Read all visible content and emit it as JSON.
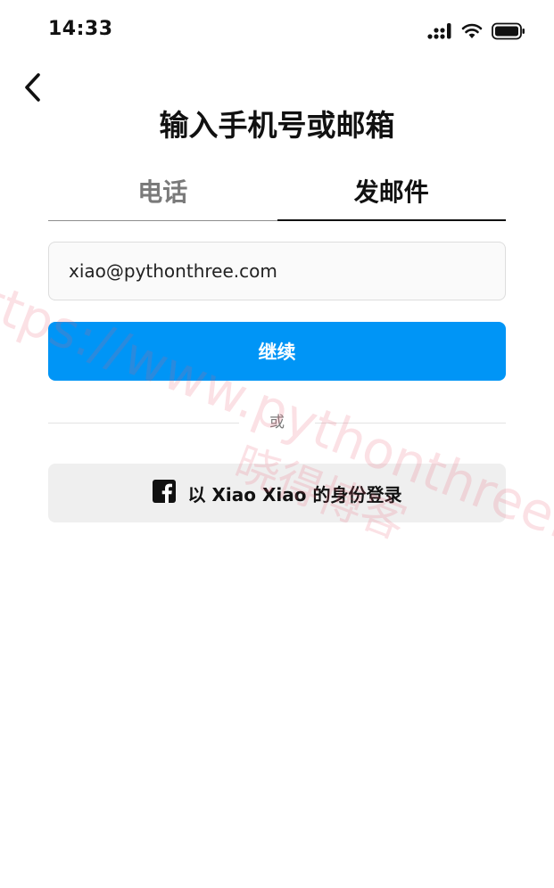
{
  "status_bar": {
    "time": "14:33"
  },
  "header": {
    "title": "输入手机号或邮箱"
  },
  "tabs": [
    {
      "label": "电话",
      "selected": false
    },
    {
      "label": "发邮件",
      "selected": true
    }
  ],
  "email_field": {
    "value": "xiao@pythonthree.com"
  },
  "continue_button": {
    "label": "继续"
  },
  "divider": {
    "text": "或"
  },
  "facebook_login": {
    "label": "以 Xiao Xiao 的身份登录",
    "icon": "facebook-icon"
  },
  "watermark": {
    "url": "https://www.pythonthree.com",
    "text": "晓得博客"
  },
  "colors": {
    "primary": "#0095f6",
    "secondary_button_bg": "#efefef",
    "watermark": "#e85a6e"
  }
}
